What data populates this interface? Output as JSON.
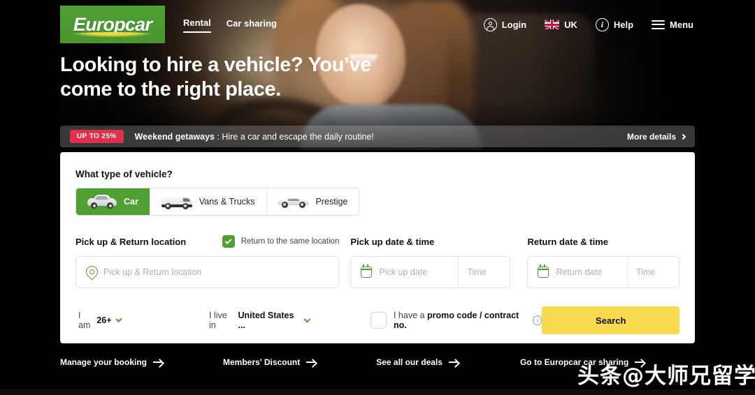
{
  "header": {
    "logo_text": "Europcar",
    "nav_tabs": [
      {
        "label": "Rental",
        "active": true
      },
      {
        "label": "Car sharing",
        "active": false
      }
    ],
    "right_items": [
      {
        "label": "Login",
        "icon": "person-circle-icon"
      },
      {
        "label": "UK",
        "icon": "uk-flag-icon"
      },
      {
        "label": "Help",
        "icon": "info-circle-icon"
      },
      {
        "label": "Menu",
        "icon": "hamburger-menu-icon"
      }
    ]
  },
  "hero": {
    "headline_line1": "Looking to hire a vehicle? You’ve",
    "headline_line2": "come to the right place."
  },
  "promo_banner": {
    "badge": "UP TO 25%",
    "title": "Weekend getaways",
    "separator": " : ",
    "description": "Hire a car and escape the daily routine!",
    "more_label": "More details",
    "badge_color": "#e0304b"
  },
  "search_card": {
    "vehicle_question": "What type of vehicle?",
    "vehicle_tabs": [
      {
        "label": "Car",
        "icon": "car-icon",
        "active": true
      },
      {
        "label": "Vans & Trucks",
        "icon": "van-icon",
        "active": false
      },
      {
        "label": "Prestige",
        "icon": "prestige-car-icon",
        "active": false
      }
    ],
    "location": {
      "label": "Pick up & Return location",
      "same_location_label": "Return to the same location",
      "same_location_checked": true,
      "placeholder": "Pick up & Return location",
      "value": ""
    },
    "pickup": {
      "label": "Pick up date & time",
      "date_placeholder": "Pick up date",
      "date_value": "",
      "time_placeholder": "Time",
      "time_value": ""
    },
    "return": {
      "label": "Return date & time",
      "date_placeholder": "Return date",
      "date_value": "",
      "time_placeholder": "Time",
      "time_value": ""
    },
    "age": {
      "prefix": "I am",
      "value": "26+"
    },
    "country": {
      "prefix": "I live in",
      "value": "United States ..."
    },
    "promo_code": {
      "prefix": "I have a",
      "strong": "promo code / contract no.",
      "checked": false
    },
    "search_button": "Search",
    "accent_green": "#4f9f33",
    "search_button_color": "#f8da4e"
  },
  "footer": {
    "links": [
      {
        "label": "Manage your booking"
      },
      {
        "label": "Members' Discount"
      },
      {
        "label": "See all our deals"
      },
      {
        "label": "Go to Europcar car sharing"
      }
    ]
  },
  "watermark": {
    "text": "头条@大师兄留学"
  }
}
